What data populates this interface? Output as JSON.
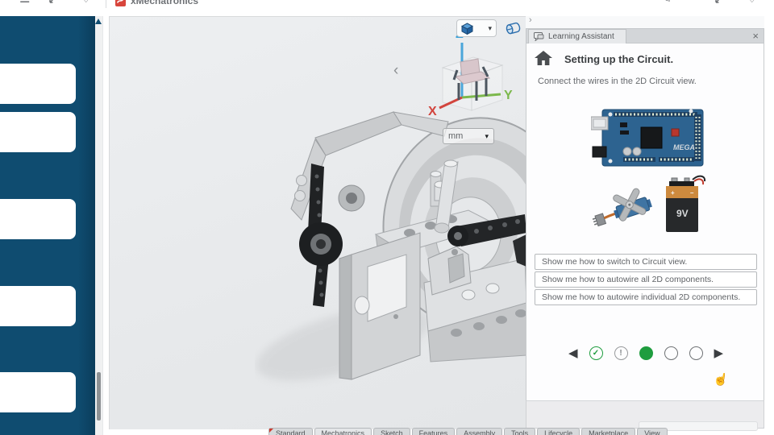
{
  "app": {
    "title": "xMechatronics"
  },
  "icons": {
    "menu": "☰",
    "heart": "♡",
    "pencil": "✎",
    "minimize": "─",
    "close": "×",
    "caret_down": "▾",
    "chevron_right": "›",
    "chevron_left": "‹",
    "check": "✓",
    "exclamation": "!",
    "prev": "◀",
    "next": "▶",
    "hand_pointer": "☝"
  },
  "viewport": {
    "units": "mm",
    "axes": {
      "x": "X",
      "y": "Y",
      "z": "Z"
    }
  },
  "assistant": {
    "tab": "Learning Assistant",
    "title": "Setting up the Circuit.",
    "description": "Connect the wires in the 2D Circuit view.",
    "suggestions": [
      "Show me how to switch to Circuit view.",
      "Show me how to autowire all 2D components.",
      "Show me how to autowire individual 2D components."
    ],
    "images": {
      "board_label": "MEGA",
      "battery_label": "9V"
    },
    "progress": {
      "total_steps": 5,
      "states": [
        "done",
        "warning",
        "current",
        "todo",
        "todo"
      ]
    }
  },
  "tabs": [
    "Standard",
    "Mechatronics",
    "Sketch",
    "Features",
    "Assembly",
    "Tools",
    "Lifecycle",
    "Marketplace",
    "View"
  ],
  "colors": {
    "sidebar_navy": "#0f4c70",
    "accent_green": "#1f9d3f",
    "logo_red": "#d8453c",
    "axis_x": "#d2453e",
    "axis_y": "#7cb84c",
    "axis_z": "#3ba2d9",
    "board_blue": "#2d6390"
  }
}
